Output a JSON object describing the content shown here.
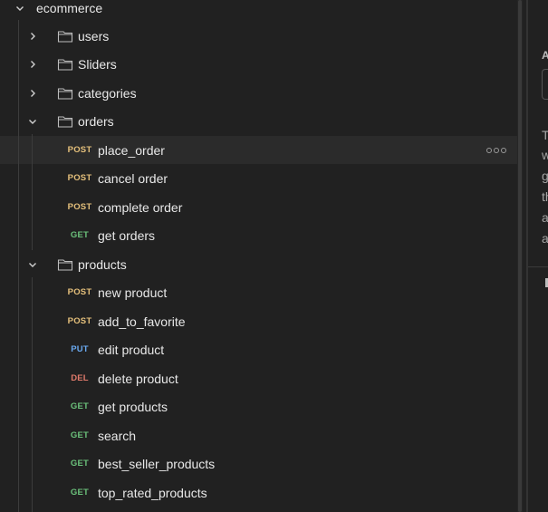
{
  "collection": {
    "name": "ecommerce",
    "folders": [
      {
        "name": "users",
        "expanded": false
      },
      {
        "name": "Sliders",
        "expanded": false
      },
      {
        "name": "categories",
        "expanded": false
      },
      {
        "name": "orders",
        "expanded": true,
        "requests": [
          {
            "method": "POST",
            "name": "place_order",
            "selected": true
          },
          {
            "method": "POST",
            "name": "cancel order"
          },
          {
            "method": "POST",
            "name": "complete order"
          },
          {
            "method": "GET",
            "name": "get orders"
          }
        ]
      },
      {
        "name": "products",
        "expanded": true,
        "requests": [
          {
            "method": "POST",
            "name": "new product"
          },
          {
            "method": "POST",
            "name": "add_to_favorite"
          },
          {
            "method": "PUT",
            "name": "edit product"
          },
          {
            "method": "DEL",
            "name": "delete product"
          },
          {
            "method": "GET",
            "name": "get products"
          },
          {
            "method": "GET",
            "name": "search"
          },
          {
            "method": "GET",
            "name": "best_seller_products"
          },
          {
            "method": "GET",
            "name": "top_rated_products"
          }
        ]
      }
    ]
  },
  "right_panel": {
    "heading": "A",
    "lines": [
      "T",
      "w",
      "g",
      "th",
      "a",
      "a"
    ]
  },
  "colors": {
    "POST": "#e5c07b",
    "GET": "#6bc17b",
    "PUT": "#6aa9f0",
    "DEL": "#e07a6b"
  }
}
